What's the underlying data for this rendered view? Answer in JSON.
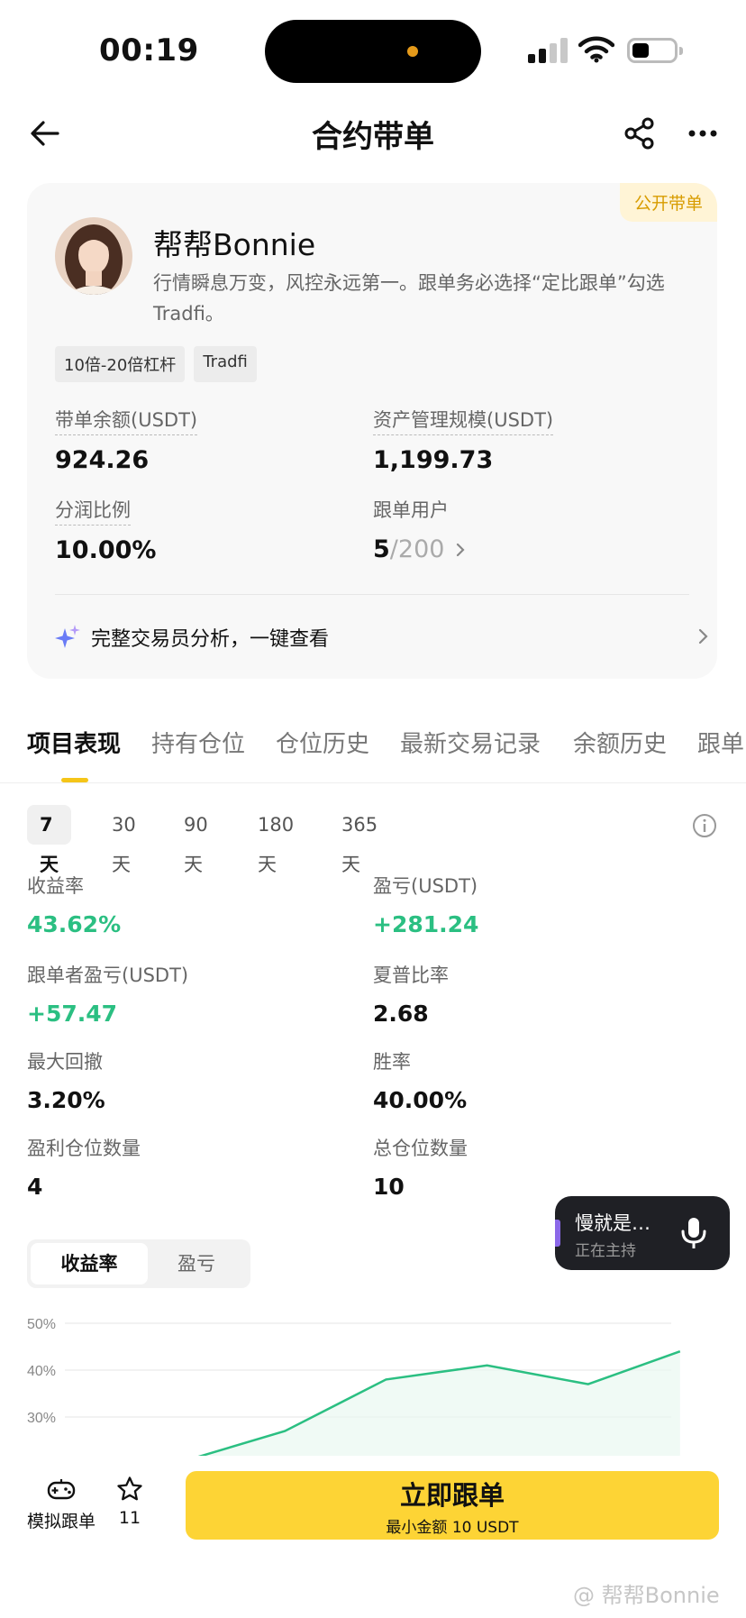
{
  "status_bar": {
    "time": "00:19"
  },
  "nav": {
    "title": "合约带单"
  },
  "profile": {
    "badge": "公开带单",
    "name": "帮帮Bonnie",
    "bio": "行情瞬息万变，风控永远第一。跟单务必选择“定比跟单”勾选Tradfi。",
    "tags": [
      "10倍-20倍杠杆",
      "Tradfi"
    ],
    "stats": {
      "balance_label": "带单余额(USDT)",
      "balance_value": "924.26",
      "aum_label": "资产管理规模(USDT)",
      "aum_value": "1,199.73",
      "share_label": "分润比例",
      "share_value": "10.00%",
      "followers_label": "跟单用户",
      "followers_current": "5",
      "followers_max": "/200"
    },
    "analysis_text": "完整交易员分析，一键查看"
  },
  "tabs": [
    "项目表现",
    "持有仓位",
    "仓位历史",
    "最新交易记录",
    "余额历史",
    "跟单"
  ],
  "periods": [
    "7天",
    "30天",
    "90天",
    "180天",
    "365天"
  ],
  "metrics": {
    "roi_label": "收益率",
    "roi_value": "43.62%",
    "pnl_label": "盈亏(USDT)",
    "pnl_value": "+281.24",
    "follower_pnl_label": "跟单者盈亏(USDT)",
    "follower_pnl_value": "+57.47",
    "sharpe_label": "夏普比率",
    "sharpe_value": "2.68",
    "mdd_label": "最大回撤",
    "mdd_value": "3.20%",
    "winrate_label": "胜率",
    "winrate_value": "40.00%",
    "profit_positions_label": "盈利仓位数量",
    "profit_positions_value": "4",
    "total_positions_label": "总仓位数量",
    "total_positions_value": "10"
  },
  "floating": {
    "title": "慢就是…",
    "subtitle": "正在主持"
  },
  "chart_toggle": [
    "收益率",
    "盈亏"
  ],
  "chart_data": {
    "type": "area",
    "ylabel_ticks": [
      "50%",
      "40%",
      "30%"
    ],
    "ylim": [
      20,
      50
    ],
    "x": [
      1,
      2,
      3,
      4,
      5,
      6,
      7
    ],
    "values": [
      20,
      27,
      38,
      41,
      37,
      44
    ],
    "x_points": [
      1.9,
      3.1,
      4.2,
      5.3,
      6.4,
      7.4
    ],
    "grid": true,
    "color": "#2bbf82"
  },
  "bottom": {
    "sim_label": "模拟跟单",
    "fav_count": "11",
    "follow_main": "立即跟单",
    "follow_sub": "最小金额 10 USDT",
    "watermark": "@ 帮帮Bonnie"
  },
  "colors": {
    "accent": "#f5c518",
    "button": "#fdd435",
    "green": "#2bbf82"
  }
}
